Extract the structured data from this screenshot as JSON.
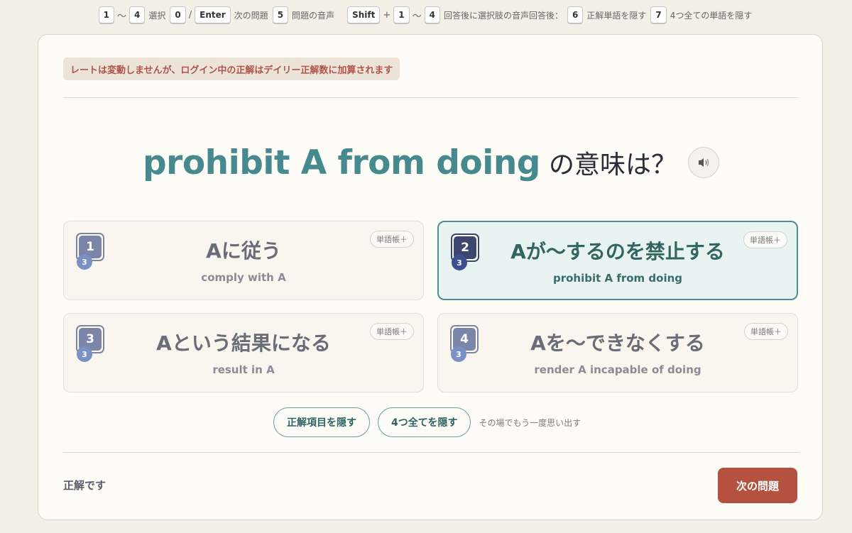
{
  "shortcuts": {
    "k1": "1",
    "tilde1": "〜",
    "k4": "4",
    "select_label": "選択",
    "k0": "0",
    "slash": "/",
    "kEnter": "Enter",
    "next_label": "次の問題",
    "k5": "5",
    "audio_label": "問題の音声",
    "kShift": "Shift",
    "plus": "+",
    "k1b": "1",
    "tilde2": "〜",
    "k4b": "4",
    "answer_audio_label": "回答後に選択肢の音声回答後：",
    "k6": "6",
    "hide_correct_label": "正解単語を隠す",
    "k7": "7",
    "hide_all_label": "4つ全ての単語を隠す"
  },
  "notice": "レートは変動しませんが、ログイン中の正解はデイリー正解数に加算されます",
  "question": {
    "term": "prohibit A from doing",
    "suffix": "の意味は？",
    "audio_icon": "speaker-icon"
  },
  "choices": [
    {
      "number": "1",
      "badge": "3",
      "vocab": "単語帳＋",
      "title": "Aに従う",
      "sub": "comply with A",
      "correct": false
    },
    {
      "number": "2",
      "badge": "3",
      "vocab": "単語帳＋",
      "title": "Aが〜するのを禁止する",
      "sub": "prohibit A from doing",
      "correct": true
    },
    {
      "number": "3",
      "badge": "3",
      "vocab": "単語帳＋",
      "title": "Aという結果になる",
      "sub": "result in A",
      "correct": false
    },
    {
      "number": "4",
      "badge": "3",
      "vocab": "単語帳＋",
      "title": "Aを〜できなくする",
      "sub": "render A incapable of doing",
      "correct": false
    }
  ],
  "hide": {
    "hide_correct": "正解項目を隠す",
    "hide_all": "4つ全てを隠す",
    "hint": "その場でもう一度思い出す"
  },
  "status": "正解です",
  "next_button": "次の問題",
  "colors": {
    "accent": "#46898e",
    "next_button": "#b4523f",
    "notice_text": "#b0544a",
    "correct_border": "#4e8d91"
  }
}
